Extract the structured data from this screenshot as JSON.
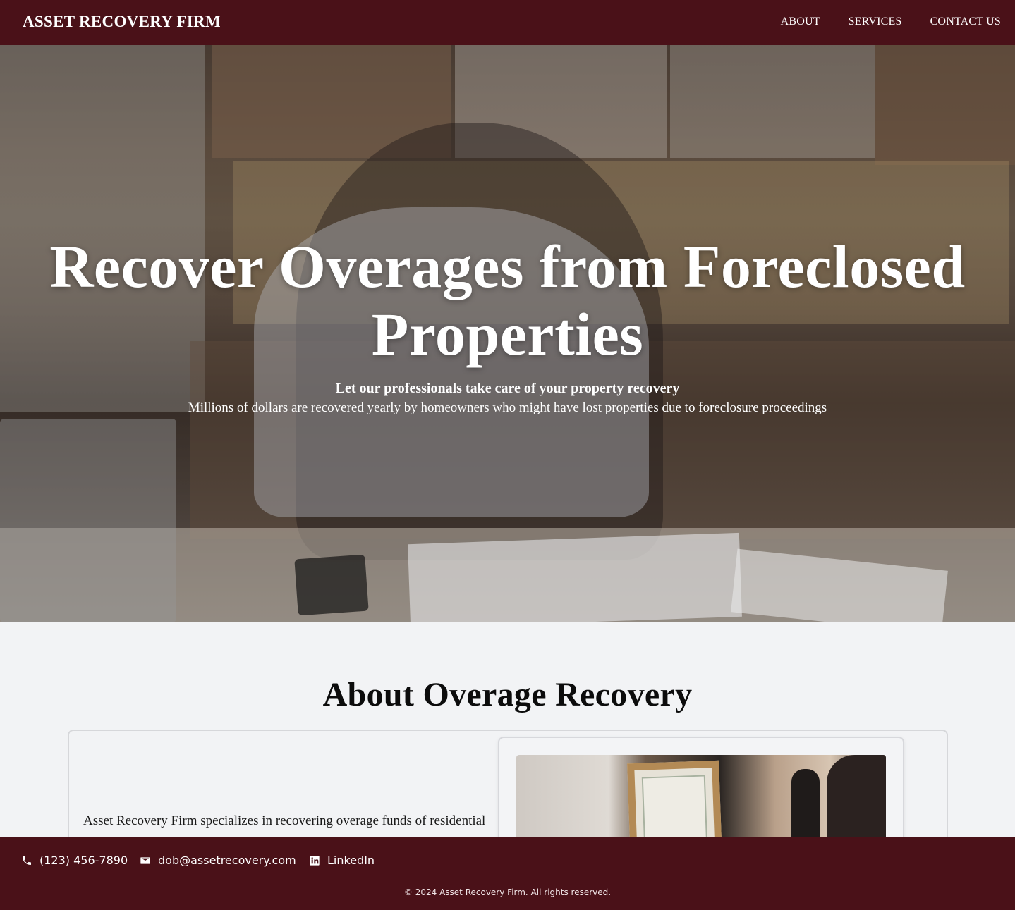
{
  "header": {
    "brand": "ASSET RECOVERY FIRM",
    "nav": [
      {
        "label": "ABOUT"
      },
      {
        "label": "SERVICES"
      },
      {
        "label": "CONTACT US"
      }
    ]
  },
  "hero": {
    "title": "Recover Overages from Foreclosed Properties",
    "subtitle": "Let our professionals take care of your property recovery",
    "description": "Millions of dollars are recovered yearly by homeowners who might have lost properties due to foreclosure proceedings"
  },
  "about": {
    "title": "About Overage Recovery",
    "text": "Asset Recovery Firm specializes in recovering overage funds of residential"
  },
  "footer": {
    "phone": "(123) 456-7890",
    "email": "dob@assetrecovery.com",
    "linkedin": "LinkedIn",
    "copyright": "© 2024 Asset Recovery Firm. All rights reserved."
  },
  "colors": {
    "brand": "#4a1118",
    "background": "#f2f3f5"
  },
  "icons": {
    "phone": "phone-icon",
    "email": "mail-icon",
    "linkedin": "linkedin-icon"
  }
}
